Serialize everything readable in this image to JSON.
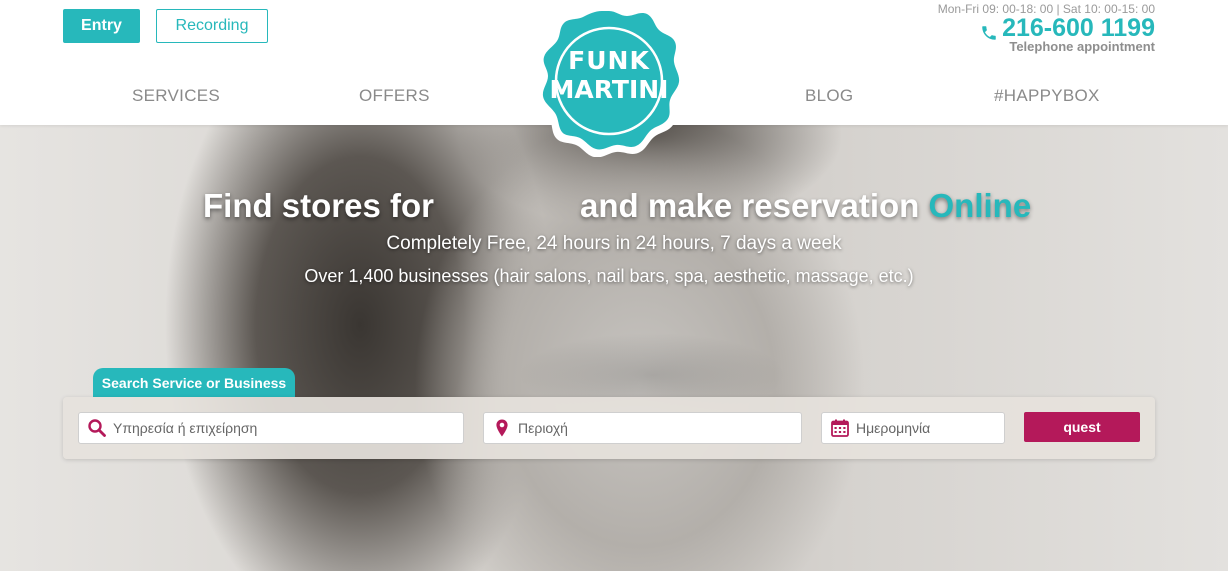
{
  "header": {
    "entry_label": "Entry",
    "recording_label": "Recording",
    "hours": "Mon-Fri 09: 00-18: 00 | Sat 10: 00-15: 00",
    "phone": "216-600 1199",
    "phone_caption": "Telephone appointment",
    "phone_icon": "phone-icon"
  },
  "nav": {
    "services": "SERVICES",
    "offers": "OFFERS",
    "blog": "BLOG",
    "happybox": "#HAPPYBOX"
  },
  "logo": {
    "line1": "FUNK",
    "line2": "MARTINI"
  },
  "hero": {
    "title_part1": "Find stores for",
    "title_part2": "and make reservation",
    "title_accent": "Online",
    "subtitle1": "Completely Free, 24 hours in 24 hours, 7 days a week",
    "subtitle2": "Over 1,400 businesses (hair salons, nail bars, spa, aesthetic, massage, etc.)"
  },
  "search": {
    "tab_label": "Search Service or Business",
    "service_placeholder": "Υπηρεσία ή επιχείρηση",
    "area_placeholder": "Περιοχή",
    "date_placeholder": "Ημερομηνία",
    "button_label": "quest"
  },
  "colors": {
    "accent": "#27b8bb",
    "search_button": "#b4195a",
    "icon": "#b4195a"
  }
}
